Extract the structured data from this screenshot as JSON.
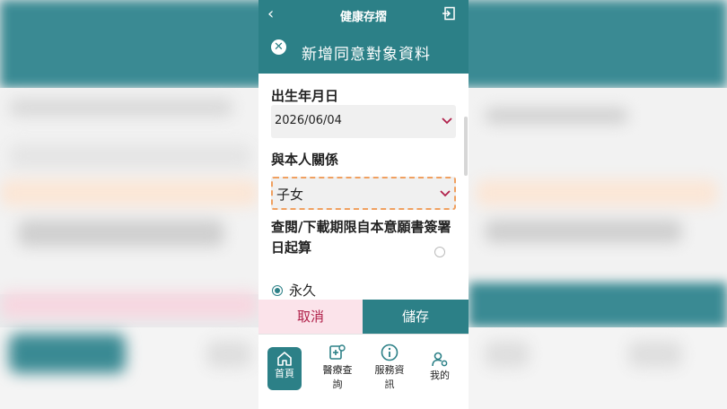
{
  "app": {
    "title": "健康存摺"
  },
  "dialog": {
    "title": "新增同意對象資料"
  },
  "form": {
    "birth_label": "出生年月日",
    "birth_value": "2026/06/04",
    "relation_label": "與本人關係",
    "relation_value": "子女",
    "period_label": "查閱/下載期限自本意願書簽署日起算",
    "option_forever": "永久"
  },
  "actions": {
    "cancel": "取消",
    "save": "儲存"
  },
  "nav": {
    "items": [
      {
        "label": "首頁",
        "icon": "home-icon"
      },
      {
        "label": "醫療查詢",
        "icon": "medical-search-icon"
      },
      {
        "label": "服務資訊",
        "icon": "info-icon"
      },
      {
        "label": "我的",
        "icon": "user-settings-icon"
      }
    ]
  },
  "colors": {
    "primary": "#2c8087",
    "accent": "#b0204a",
    "highlight": "#f0a060"
  }
}
